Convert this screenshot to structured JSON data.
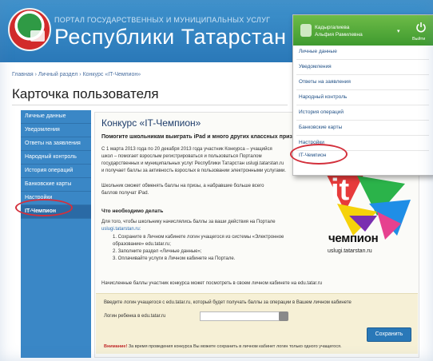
{
  "header": {
    "portal_small": "Портал государственных и муниципальных услуг",
    "portal_big": "Республики Татарстан"
  },
  "breadcrumb": "Главная › Личный раздел › Конкурс «IT-Чемпион»",
  "page_title": "Карточка пользователя",
  "sidebar": {
    "items": [
      {
        "label": "Личные данные"
      },
      {
        "label": "Уведомления"
      },
      {
        "label": "Ответы на заявления"
      },
      {
        "label": "Народный контроль"
      },
      {
        "label": "История операций"
      },
      {
        "label": "Банковские карты"
      },
      {
        "label": "Настройки"
      },
      {
        "label": "IT-Чемпион"
      }
    ]
  },
  "content": {
    "title": "Конкурс «IT-Чемпион»",
    "subtitle": "Помогите школьникам выиграть iPad и много других классных призов!",
    "para1": [
      "С 1 марта 2013 года по 20 декабря 2013 года участник Конкурса – учащийся",
      "школ – помогает взрослым регистрироваться и пользоваться Порталом",
      "государственных и муниципальных услуг Республики Татарстан uslugi.tatarstan.ru",
      "и получает баллы за активность взрослых в пользовании электронными услугами."
    ],
    "para2": [
      "Школьник сможет обменять баллы на призы, а набравшие больше всего",
      "баллов получат iPad."
    ],
    "heading_todo": "Что необходимо делать",
    "para3": [
      "Для того, чтобы школьнику начислялись баллы за ваши действия на Портале",
      "uslugi.tatarstan.ru:"
    ],
    "steps": [
      "1.  Сохраните в Личном кабинете логин учащегося из системы «Электронное",
      "     образование» edu.tatar.ru;",
      "2.  Заполните раздел «Личные данные»;",
      "3.  Оплачивайте услуги в Личном кабинете на Портале."
    ],
    "para4": "Начисленные баллы участник конкурса может посмотреть в своем личном кабинете на edu.tatar.ru"
  },
  "form": {
    "intro": "Введите логин учащегося с edu.tatar.ru, который будет получать баллы за операции в Вашем личном кабинете",
    "login_label": "Логин ребенка в edu.tatar.ru",
    "login_value": "",
    "save_label": "Сохранить",
    "warning_label": "Внимание!",
    "warning_text": " За время проведения конкурса Вы можете сохранить в личном кабинет логин только одного учащегося."
  },
  "champion": {
    "it_text": "it",
    "title": "чемпион",
    "url": "uslugi.tatarstan.ru"
  },
  "user_menu": {
    "name_line1": "Кадыргалиева",
    "name_line2": "Альфия Рамилевна",
    "caret": "▾",
    "exit_label": "Выйти",
    "items": [
      {
        "label": "Личные данные"
      },
      {
        "label": "Уведомления"
      },
      {
        "label": "Ответы на заявления"
      },
      {
        "label": "Народный контроль"
      },
      {
        "label": "История операций"
      },
      {
        "label": "Банковские карты"
      },
      {
        "label": "Настройки"
      },
      {
        "label": "IT-Чемпион"
      }
    ]
  },
  "colors": {
    "header_blue": "#2a78b8",
    "sidebar_blue": "#3a87c6",
    "menu_green": "#4ea637",
    "highlight_red": "#d3303c",
    "form_bg": "#f6f0d6"
  },
  "icons": [
    "tatarstan-emblem-icon",
    "user-avatar-icon",
    "power-icon",
    "search-icon"
  ]
}
